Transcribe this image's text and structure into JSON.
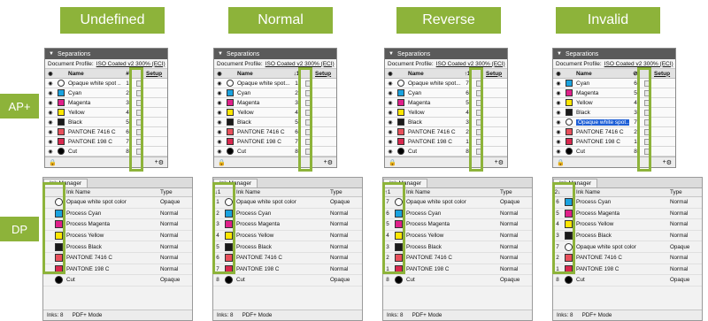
{
  "columns": [
    "Undefined",
    "Normal",
    "Reverse",
    "Invalid"
  ],
  "row_labels": {
    "top": "AP+",
    "bottom": "DP"
  },
  "separations": {
    "title": "Separations",
    "profile_label": "Document Profile:",
    "profile_value": "ISO Coated v2 300% (ECI)",
    "header": {
      "name": "Name",
      "setup": "Setup"
    },
    "sort_icons": [
      "#",
      "↓1",
      "↑1",
      "⊘"
    ],
    "panels": [
      {
        "rows": [
          {
            "name": "Opaque white spot ...",
            "no": "1",
            "sw": "#ffffff",
            "round": true
          },
          {
            "name": "Cyan",
            "no": "2",
            "sw": "#1aa3e0",
            "round": false
          },
          {
            "name": "Magenta",
            "no": "3",
            "sw": "#e0208a",
            "round": false
          },
          {
            "name": "Yellow",
            "no": "4",
            "sw": "#ffe600",
            "round": false
          },
          {
            "name": "Black",
            "no": "5",
            "sw": "#1a1a1a",
            "round": false
          },
          {
            "name": "PANTONE 7416 C",
            "no": "6",
            "sw": "#e8505b",
            "round": false
          },
          {
            "name": "PANTONE 198 C",
            "no": "7",
            "sw": "#d9284e",
            "round": false
          },
          {
            "name": "Cut",
            "no": "8",
            "sw": "#000000",
            "round": true
          }
        ]
      },
      {
        "rows": [
          {
            "name": "Opaque white spot...",
            "no": "1",
            "sw": "#ffffff",
            "round": true
          },
          {
            "name": "Cyan",
            "no": "2",
            "sw": "#1aa3e0",
            "round": false
          },
          {
            "name": "Magenta",
            "no": "3",
            "sw": "#e0208a",
            "round": false
          },
          {
            "name": "Yellow",
            "no": "4",
            "sw": "#ffe600",
            "round": false
          },
          {
            "name": "Black",
            "no": "5",
            "sw": "#1a1a1a",
            "round": false
          },
          {
            "name": "PANTONE 7416 C",
            "no": "6",
            "sw": "#e8505b",
            "round": false
          },
          {
            "name": "PANTONE 198 C",
            "no": "7",
            "sw": "#d9284e",
            "round": false
          },
          {
            "name": "Cut",
            "no": "8",
            "sw": "#000000",
            "round": true
          }
        ]
      },
      {
        "rows": [
          {
            "name": "Opaque white spot...",
            "no": "7",
            "sw": "#ffffff",
            "round": true
          },
          {
            "name": "Cyan",
            "no": "6",
            "sw": "#1aa3e0",
            "round": false
          },
          {
            "name": "Magenta",
            "no": "5",
            "sw": "#e0208a",
            "round": false
          },
          {
            "name": "Yellow",
            "no": "4",
            "sw": "#ffe600",
            "round": false
          },
          {
            "name": "Black",
            "no": "3",
            "sw": "#1a1a1a",
            "round": false
          },
          {
            "name": "PANTONE 7416 C",
            "no": "2",
            "sw": "#e8505b",
            "round": false
          },
          {
            "name": "PANTONE 198 C",
            "no": "1",
            "sw": "#d9284e",
            "round": false
          },
          {
            "name": "Cut",
            "no": "8",
            "sw": "#000000",
            "round": true
          }
        ]
      },
      {
        "rows": [
          {
            "name": "Cyan",
            "no": "6",
            "sw": "#1aa3e0",
            "round": false
          },
          {
            "name": "Magenta",
            "no": "5",
            "sw": "#e0208a",
            "round": false
          },
          {
            "name": "Yellow",
            "no": "4",
            "sw": "#ffe600",
            "round": false
          },
          {
            "name": "Black",
            "no": "3",
            "sw": "#1a1a1a",
            "round": false
          },
          {
            "name": "Opaque white spot...",
            "no": "7",
            "sw": "#ffffff",
            "round": true,
            "selected": true
          },
          {
            "name": "PANTONE 7416 C",
            "no": "2",
            "sw": "#e8505b",
            "round": false
          },
          {
            "name": "PANTONE 198 C",
            "no": "1",
            "sw": "#d9284e",
            "round": false
          },
          {
            "name": "Cut",
            "no": "8",
            "sw": "#000000",
            "round": true
          }
        ]
      }
    ]
  },
  "ink_manager": {
    "tab": "Ink Manager",
    "header": {
      "name": "Ink Name",
      "type": "Type"
    },
    "sort_icons": [
      "",
      "↓1",
      "↑1",
      "2↓"
    ],
    "footer_inks": "Inks: 8",
    "footer_mode": "PDF+ Mode",
    "panels": [
      {
        "rows": [
          {
            "no": "",
            "name": "Opaque white spot color",
            "type": "Opaque",
            "sw": "#ffffff",
            "round": true
          },
          {
            "no": "",
            "name": "Process Cyan",
            "type": "Normal",
            "sw": "#1aa3e0",
            "round": false
          },
          {
            "no": "",
            "name": "Process Magenta",
            "type": "Normal",
            "sw": "#e0208a",
            "round": false
          },
          {
            "no": "",
            "name": "Process Yellow",
            "type": "Normal",
            "sw": "#ffe600",
            "round": false
          },
          {
            "no": "",
            "name": "Process Black",
            "type": "Normal",
            "sw": "#1a1a1a",
            "round": false
          },
          {
            "no": "",
            "name": "PANTONE 7416 C",
            "type": "Normal",
            "sw": "#e8505b",
            "round": false
          },
          {
            "no": "",
            "name": "PANTONE 198 C",
            "type": "Normal",
            "sw": "#d9284e",
            "round": false
          },
          {
            "no": "",
            "name": "Cut",
            "type": "Opaque",
            "sw": "#000000",
            "round": true
          }
        ]
      },
      {
        "rows": [
          {
            "no": "1",
            "name": "Opaque white spot color",
            "type": "Opaque",
            "sw": "#ffffff",
            "round": true
          },
          {
            "no": "2",
            "name": "Process Cyan",
            "type": "Normal",
            "sw": "#1aa3e0",
            "round": false
          },
          {
            "no": "3",
            "name": "Process Magenta",
            "type": "Normal",
            "sw": "#e0208a",
            "round": false
          },
          {
            "no": "4",
            "name": "Process Yellow",
            "type": "Normal",
            "sw": "#ffe600",
            "round": false
          },
          {
            "no": "5",
            "name": "Process Black",
            "type": "Normal",
            "sw": "#1a1a1a",
            "round": false
          },
          {
            "no": "6",
            "name": "PANTONE 7416 C",
            "type": "Normal",
            "sw": "#e8505b",
            "round": false
          },
          {
            "no": "7",
            "name": "PANTONE 198 C",
            "type": "Normal",
            "sw": "#d9284e",
            "round": false
          },
          {
            "no": "8",
            "name": "Cut",
            "type": "Opaque",
            "sw": "#000000",
            "round": true
          }
        ]
      },
      {
        "rows": [
          {
            "no": "7",
            "name": "Opaque white spot color",
            "type": "Opaque",
            "sw": "#ffffff",
            "round": true
          },
          {
            "no": "6",
            "name": "Process Cyan",
            "type": "Normal",
            "sw": "#1aa3e0",
            "round": false
          },
          {
            "no": "5",
            "name": "Process Magenta",
            "type": "Normal",
            "sw": "#e0208a",
            "round": false
          },
          {
            "no": "4",
            "name": "Process Yellow",
            "type": "Normal",
            "sw": "#ffe600",
            "round": false
          },
          {
            "no": "3",
            "name": "Process Black",
            "type": "Normal",
            "sw": "#1a1a1a",
            "round": false
          },
          {
            "no": "2",
            "name": "PANTONE 7416 C",
            "type": "Normal",
            "sw": "#e8505b",
            "round": false
          },
          {
            "no": "1",
            "name": "PANTONE 198 C",
            "type": "Normal",
            "sw": "#d9284e",
            "round": false
          },
          {
            "no": "8",
            "name": "Cut",
            "type": "Opaque",
            "sw": "#000000",
            "round": true
          }
        ]
      },
      {
        "rows": [
          {
            "no": "6",
            "name": "Process Cyan",
            "type": "Normal",
            "sw": "#1aa3e0",
            "round": false
          },
          {
            "no": "5",
            "name": "Process Magenta",
            "type": "Normal",
            "sw": "#e0208a",
            "round": false
          },
          {
            "no": "4",
            "name": "Process Yellow",
            "type": "Normal",
            "sw": "#ffe600",
            "round": false
          },
          {
            "no": "3",
            "name": "Process Black",
            "type": "Normal",
            "sw": "#1a1a1a",
            "round": false
          },
          {
            "no": "7",
            "name": "Opaque white spot color",
            "type": "Opaque",
            "sw": "#ffffff",
            "round": true
          },
          {
            "no": "2",
            "name": "PANTONE 7416 C",
            "type": "Normal",
            "sw": "#e8505b",
            "round": false
          },
          {
            "no": "1",
            "name": "PANTONE 198 C",
            "type": "Normal",
            "sw": "#d9284e",
            "round": false
          },
          {
            "no": "8",
            "name": "Cut",
            "type": "Opaque",
            "sw": "#000000",
            "round": true
          }
        ]
      }
    ]
  },
  "colors": {
    "accent": "#8db33a",
    "selection": "#1e5fd6",
    "panel_header": "#5a5a5a"
  }
}
